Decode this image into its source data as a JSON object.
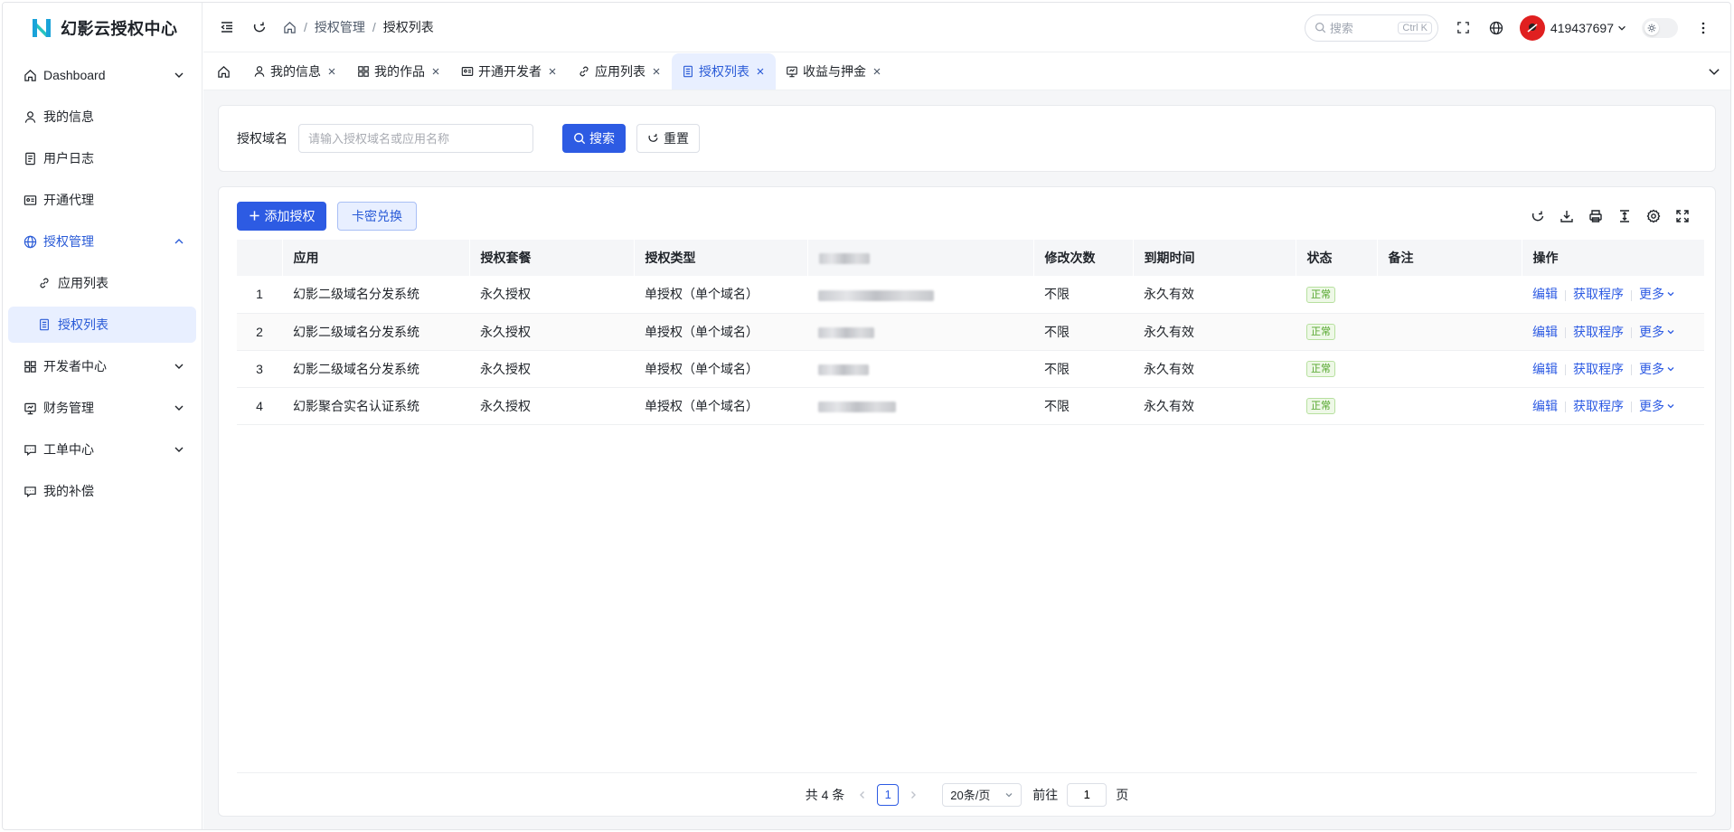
{
  "app": {
    "title": "幻影云授权中心"
  },
  "sidebar": {
    "items": [
      {
        "label": "Dashboard",
        "icon": "home-icon"
      },
      {
        "label": "我的信息",
        "icon": "user-icon"
      },
      {
        "label": "用户日志",
        "icon": "log-icon"
      },
      {
        "label": "开通代理",
        "icon": "id-card-icon"
      },
      {
        "label": "授权管理",
        "icon": "globe-icon"
      },
      {
        "label": "应用列表",
        "icon": "link-icon"
      },
      {
        "label": "授权列表",
        "icon": "document-icon"
      },
      {
        "label": "开发者中心",
        "icon": "grid-icon"
      },
      {
        "label": "财务管理",
        "icon": "finance-icon"
      },
      {
        "label": "工单中心",
        "icon": "ticket-icon"
      },
      {
        "label": "我的补偿",
        "icon": "compensation-icon"
      }
    ]
  },
  "header": {
    "breadcrumb": [
      "授权管理",
      "授权列表"
    ],
    "search_placeholder": "搜索",
    "search_shortcut": "Ctrl K",
    "username": "419437697"
  },
  "tabs": [
    {
      "label": "我的信息"
    },
    {
      "label": "我的作品"
    },
    {
      "label": "开通开发者"
    },
    {
      "label": "应用列表"
    },
    {
      "label": "授权列表"
    },
    {
      "label": "收益与押金"
    }
  ],
  "filter": {
    "label": "授权域名",
    "placeholder": "请输入授权域名或应用名称",
    "search_label": "搜索",
    "reset_label": "重置"
  },
  "toolbar": {
    "add_label": "添加授权",
    "redeem_label": "卡密兑换"
  },
  "table": {
    "columns": [
      "",
      "应用",
      "授权套餐",
      "授权类型",
      "",
      "修改次数",
      "到期时间",
      "状态",
      "备注",
      "操作"
    ],
    "rows": [
      {
        "index": "1",
        "app": "幻影二级域名分发系统",
        "package": "永久授权",
        "type": "单授权（单个域名）",
        "modify_count": "不限",
        "expire": "永久有效",
        "status": "正常",
        "note": ""
      },
      {
        "index": "2",
        "app": "幻影二级域名分发系统",
        "package": "永久授权",
        "type": "单授权（单个域名）",
        "modify_count": "不限",
        "expire": "永久有效",
        "status": "正常",
        "note": ""
      },
      {
        "index": "3",
        "app": "幻影二级域名分发系统",
        "package": "永久授权",
        "type": "单授权（单个域名）",
        "modify_count": "不限",
        "expire": "永久有效",
        "status": "正常",
        "note": ""
      },
      {
        "index": "4",
        "app": "幻影聚合实名认证系统",
        "package": "永久授权",
        "type": "单授权（单个域名）",
        "modify_count": "不限",
        "expire": "永久有效",
        "status": "正常",
        "note": ""
      }
    ],
    "actions": {
      "edit": "编辑",
      "get_program": "获取程序",
      "more": "更多"
    }
  },
  "pagination": {
    "total_text": "共 4 条",
    "current_page": "1",
    "page_size": "20条/页",
    "goto_prefix": "前往",
    "goto_value": "1",
    "goto_suffix": "页"
  },
  "colors": {
    "primary": "#2d5be3",
    "active_bg": "#e8efff",
    "success": "#52a52a"
  }
}
